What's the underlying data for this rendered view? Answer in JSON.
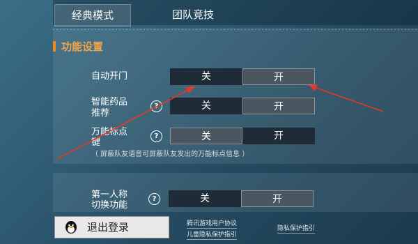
{
  "tabs": [
    {
      "label": "经典模式"
    },
    {
      "label": "团队竞技"
    }
  ],
  "section": {
    "title": "功能设置"
  },
  "settings": [
    {
      "label_lines": [
        "自动开门"
      ],
      "off": "关",
      "on": "开",
      "state": "off"
    },
    {
      "label_lines": [
        "智能药品",
        "推荐"
      ],
      "off": "关",
      "on": "开",
      "state": "on"
    },
    {
      "label_lines": [
        "万能标点",
        "键"
      ],
      "off": "关",
      "on": "开",
      "state": "on"
    },
    {
      "label_lines": [
        "第一人称",
        "切换功能"
      ],
      "off": "关",
      "on": "开",
      "state": "off"
    }
  ],
  "note": "（ 屏蔽队友语音可屏蔽队友发出的万能标点信息 ）",
  "logout": {
    "label": "退出登录"
  },
  "links": {
    "user_agreement": "腾讯游戏用户协议",
    "privacy_guide": "隐私保护指引",
    "child_privacy": "儿童隐私保护指引"
  },
  "colors": {
    "accent": "#f08a1e",
    "arrow": "#e03a2a"
  }
}
